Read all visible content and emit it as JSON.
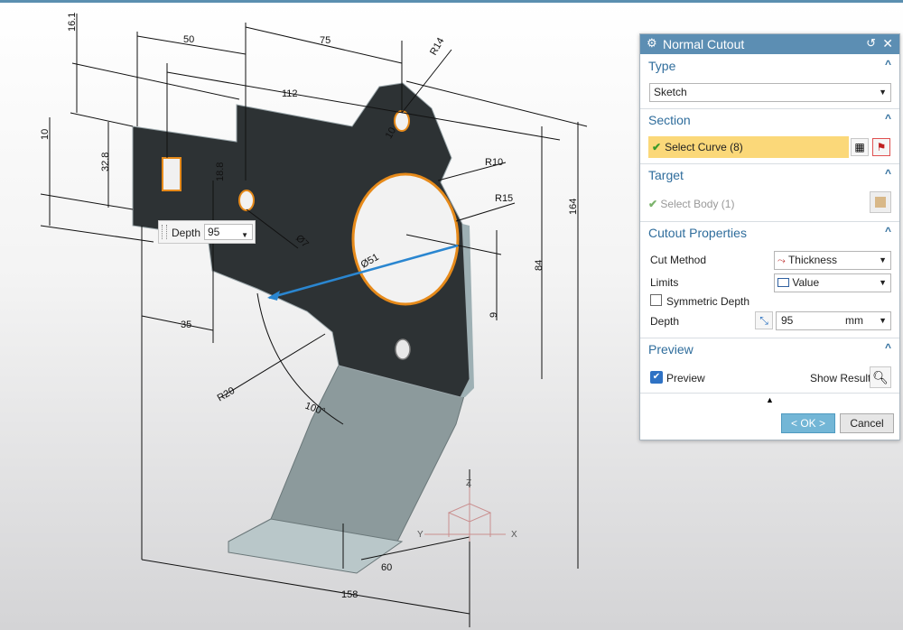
{
  "viewport": {
    "dimensions": {
      "d50": "50",
      "d75": "75",
      "d14": "R14",
      "d16_1": "16.1",
      "d112": "112",
      "d10": "10",
      "d32_8": "32.8",
      "d18_8": "18.8",
      "d10b": "10",
      "r10": "R10",
      "r15": "R15",
      "d164": "164",
      "d84": "84",
      "d9": "9",
      "d7": "Ø7",
      "d51": "Ø51",
      "d35": "35",
      "r20": "R20",
      "a100": "100°",
      "d60": "60",
      "d158": "158"
    },
    "axes": {
      "x": "X",
      "y": "Y",
      "z": "Z"
    }
  },
  "depth_box": {
    "label": "Depth",
    "value": "95"
  },
  "dialog": {
    "title": "Normal Cutout",
    "type": {
      "header": "Type",
      "value": "Sketch"
    },
    "section": {
      "header": "Section",
      "select_curve": "Select Curve (8)"
    },
    "target": {
      "header": "Target",
      "select_body": "Select Body (1)"
    },
    "cutout": {
      "header": "Cutout Properties",
      "cut_method_label": "Cut Method",
      "cut_method_value": "Thickness",
      "limits_label": "Limits",
      "limits_value": "Value",
      "symmetric_label": "Symmetric Depth",
      "depth_label": "Depth",
      "depth_value": "95",
      "depth_unit": "mm"
    },
    "preview": {
      "header": "Preview",
      "preview_label": "Preview",
      "show_result": "Show Result"
    },
    "ok_label": "< OK >",
    "cancel_label": "Cancel"
  }
}
